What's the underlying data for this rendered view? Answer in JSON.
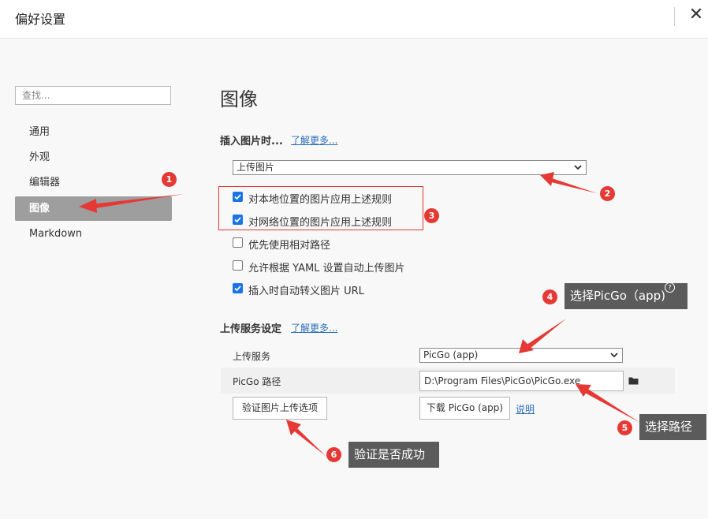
{
  "window": {
    "title": "偏好设置"
  },
  "sidebar": {
    "search_placeholder": "查找...",
    "items": [
      {
        "label": "通用",
        "active": false
      },
      {
        "label": "外观",
        "active": false
      },
      {
        "label": "编辑器",
        "active": false
      },
      {
        "label": "图像",
        "active": true
      },
      {
        "label": "Markdown",
        "active": false
      }
    ]
  },
  "main": {
    "title": "图像",
    "insert_section": {
      "label": "插入图片时...",
      "learn_more": "了解更多...",
      "dropdown_value": "上传图片",
      "options": [
        {
          "label": "对本地位置的图片应用上述规则",
          "checked": true
        },
        {
          "label": "对网络位置的图片应用上述规则",
          "checked": true
        },
        {
          "label": "优先使用相对路径",
          "checked": false
        },
        {
          "label": "允许根据 YAML 设置自动上传图片",
          "checked": false
        },
        {
          "label": "插入时自动转义图片 URL",
          "checked": true
        }
      ]
    },
    "upload_section": {
      "label": "上传服务设定",
      "learn_more": "了解更多...",
      "service_label": "上传服务",
      "service_value": "PicGo (app)",
      "path_label": "PicGo 路径",
      "path_value": "D:\\Program Files\\PicGo\\PicGo.exe",
      "verify_button": "验证图片上传选项",
      "download_button": "下载 PicGo (app)",
      "help_link": "说明"
    }
  },
  "annotations": {
    "badges": [
      "1",
      "2",
      "3",
      "4",
      "5",
      "6"
    ],
    "tips": {
      "select_picgo": "选择PicGo（app)",
      "select_path": "选择路径",
      "verify": "验证是否成功"
    },
    "help_glyph": "?",
    "accent_color": "#e53935"
  },
  "icons": {
    "close": "close-icon",
    "folder": "folder-icon",
    "chevron": "chevron-down-icon",
    "check": "check-icon"
  }
}
